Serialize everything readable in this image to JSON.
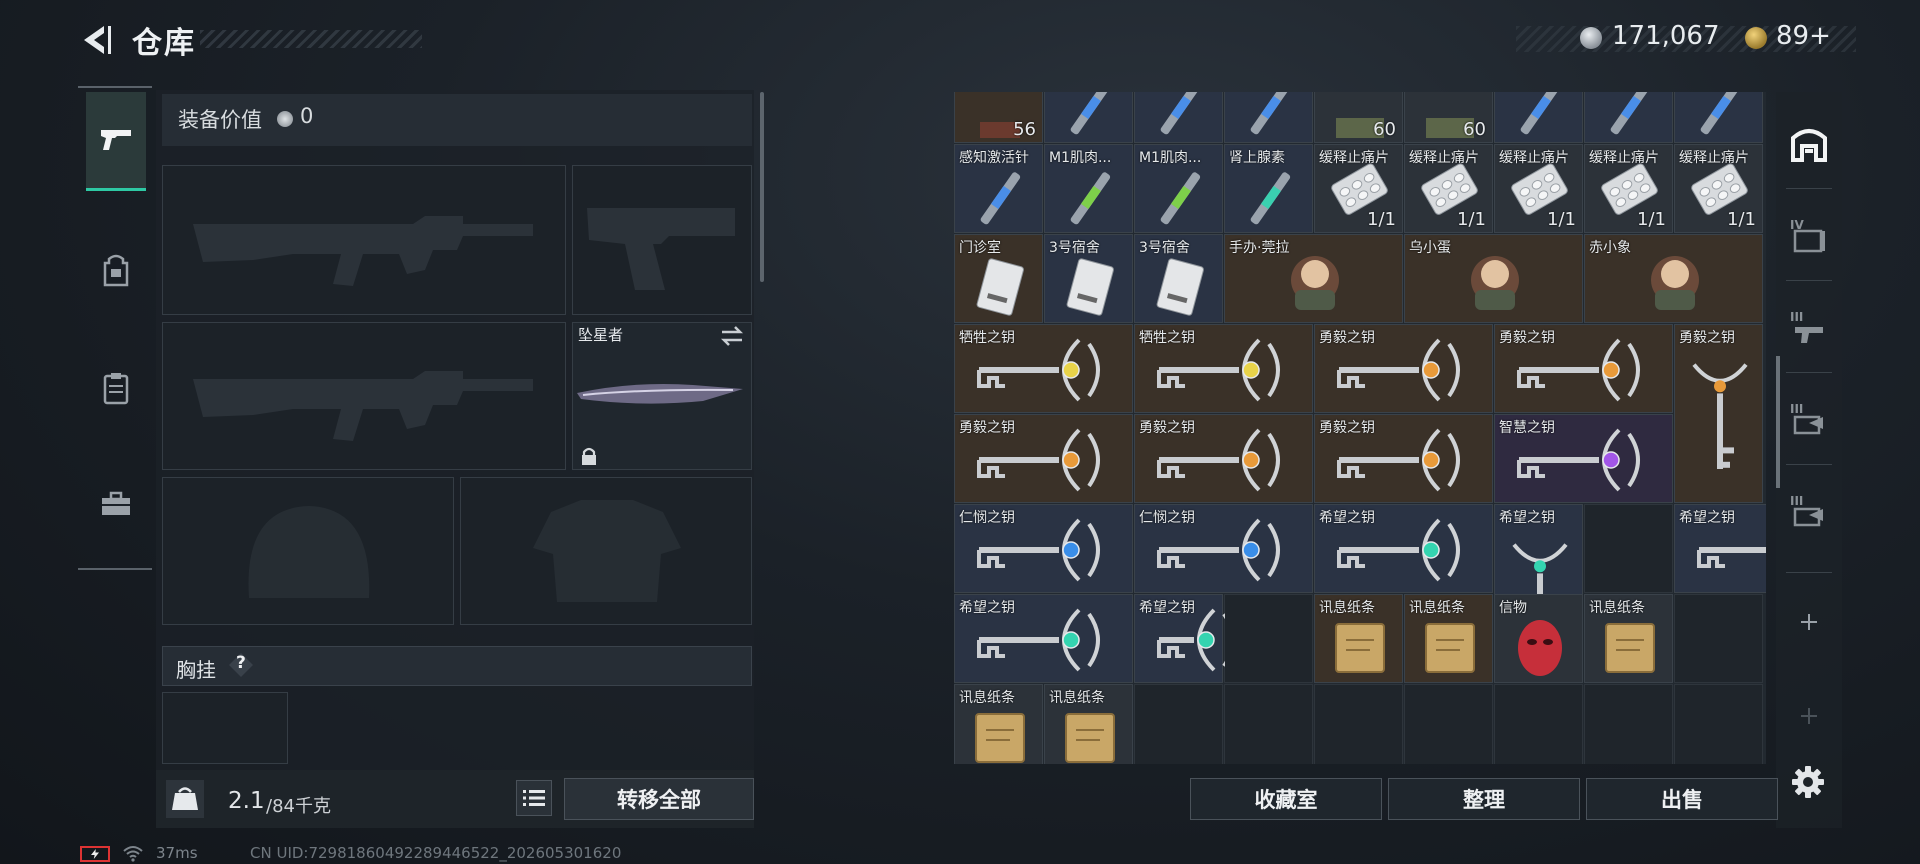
{
  "header": {
    "title": "仓库",
    "coins": "171,067",
    "tokens": "89+"
  },
  "left_tabs": [
    "firearms-tab",
    "backpack-tab",
    "vest-tab",
    "toolbox-tab"
  ],
  "equipment": {
    "value_label": "装备价值",
    "value": "0",
    "melee_name": "坠星者",
    "chest_label": "胸挂",
    "chest_help": "?",
    "weight": "2.1",
    "weight_capacity": "/84千克",
    "transfer_all": "转移全部"
  },
  "status": {
    "ping": "37ms",
    "uid": "CN UID:7298186049228944652​2_202605301620"
  },
  "storage": {
    "items": [
      {
        "label": "",
        "count": "56",
        "color": "brown",
        "icon": "item"
      },
      {
        "label": "",
        "count": "",
        "color": "blue",
        "icon": "injector"
      },
      {
        "label": "",
        "count": "",
        "color": "blue",
        "icon": "injector"
      },
      {
        "label": "",
        "count": "",
        "color": "blue",
        "icon": "injector"
      },
      {
        "label": "",
        "count": "60",
        "color": "gray",
        "icon": "box"
      },
      {
        "label": "",
        "count": "60",
        "color": "gray",
        "icon": "box"
      },
      {
        "label": "",
        "count": "",
        "color": "blue",
        "icon": "injector"
      },
      {
        "label": "",
        "count": "",
        "color": "blue",
        "icon": "injector"
      },
      {
        "label": "",
        "count": "",
        "color": "blue",
        "icon": "injector"
      },
      {
        "label": "感知激活针",
        "count": "",
        "color": "blue",
        "icon": "injector-blue"
      },
      {
        "label": "M1肌肉...",
        "count": "",
        "color": "blue",
        "icon": "injector-green"
      },
      {
        "label": "M1肌肉...",
        "count": "",
        "color": "blue",
        "icon": "injector-green"
      },
      {
        "label": "肾上腺素",
        "count": "",
        "color": "blue",
        "icon": "injector-teal"
      },
      {
        "label": "缓释止痛片",
        "count": "1/1",
        "color": "gray",
        "icon": "pills"
      },
      {
        "label": "缓释止痛片",
        "count": "1/1",
        "color": "gray",
        "icon": "pills"
      },
      {
        "label": "缓释止痛片",
        "count": "1/1",
        "color": "gray",
        "icon": "pills"
      },
      {
        "label": "缓释止痛片",
        "count": "1/1",
        "color": "gray",
        "icon": "pills"
      },
      {
        "label": "缓释止痛片",
        "count": "1/1",
        "color": "gray",
        "icon": "pills"
      },
      {
        "label": "门诊室",
        "count": "",
        "color": "brown",
        "icon": "keycard"
      },
      {
        "label": "3号宿舍",
        "count": "",
        "color": "blue",
        "icon": "keycard"
      },
      {
        "label": "3号宿舍",
        "count": "",
        "color": "blue",
        "icon": "keycard"
      },
      {
        "label": "手办·莞拉",
        "count": "",
        "color": "brown",
        "icon": "figure"
      },
      {
        "label": "乌小蛋",
        "count": "",
        "color": "brown",
        "icon": "figure"
      },
      {
        "label": "赤小象",
        "count": "",
        "color": "brown",
        "icon": "figure"
      },
      {
        "label": "牺牲之钥",
        "count": "",
        "color": "brown",
        "icon": "key-yellow"
      },
      {
        "label": "牺牲之钥",
        "count": "",
        "color": "brown",
        "icon": "key-yellow"
      },
      {
        "label": "勇毅之钥",
        "count": "",
        "color": "brown",
        "icon": "key-orange"
      },
      {
        "label": "勇毅之钥",
        "count": "",
        "color": "brown",
        "icon": "key-orange"
      },
      {
        "label": "勇毅之钥",
        "count": "",
        "color": "brown",
        "icon": "key-orange"
      },
      {
        "label": "勇毅之钥",
        "count": "",
        "color": "brown",
        "icon": "key-orange"
      },
      {
        "label": "勇毅之钥",
        "count": "",
        "color": "brown",
        "icon": "key-orange"
      },
      {
        "label": "勇毅之钥",
        "count": "",
        "color": "brown",
        "icon": "key-orange"
      },
      {
        "label": "智慧之钥",
        "count": "",
        "color": "purple",
        "icon": "key-purple"
      },
      {
        "label": "仁悯之钥",
        "count": "",
        "color": "blue",
        "icon": "key-blue"
      },
      {
        "label": "仁悯之钥",
        "count": "",
        "color": "blue",
        "icon": "key-blue"
      },
      {
        "label": "希望之钥",
        "count": "",
        "color": "blue",
        "icon": "key-green"
      },
      {
        "label": "希望之钥",
        "count": "",
        "color": "blue",
        "icon": "key-green"
      },
      {
        "label": "希望之钥",
        "count": "",
        "color": "blue",
        "icon": "key-green"
      },
      {
        "label": "希望之钥",
        "count": "",
        "color": "blue",
        "icon": "key-green"
      },
      {
        "label": "希望之钥",
        "count": "",
        "color": "blue",
        "icon": "key-green"
      },
      {
        "label": "讯息纸条",
        "count": "",
        "color": "brown",
        "icon": "note"
      },
      {
        "label": "讯息纸条",
        "count": "",
        "color": "brown",
        "icon": "note"
      },
      {
        "label": "信物",
        "count": "",
        "color": "gray",
        "icon": "mask"
      },
      {
        "label": "讯息纸条",
        "count": "",
        "color": "gray",
        "icon": "note"
      },
      {
        "label": "讯息纸条",
        "count": "",
        "color": "gray",
        "icon": "note"
      },
      {
        "label": "讯息纸条",
        "count": "",
        "color": "gray",
        "icon": "note"
      }
    ]
  },
  "actions": {
    "collection": "收藏室",
    "sort": "整理",
    "sell": "出售"
  },
  "right_tabs": {
    "level4": "IV",
    "level3a": "III",
    "level3b": "III",
    "level3c": "III"
  }
}
